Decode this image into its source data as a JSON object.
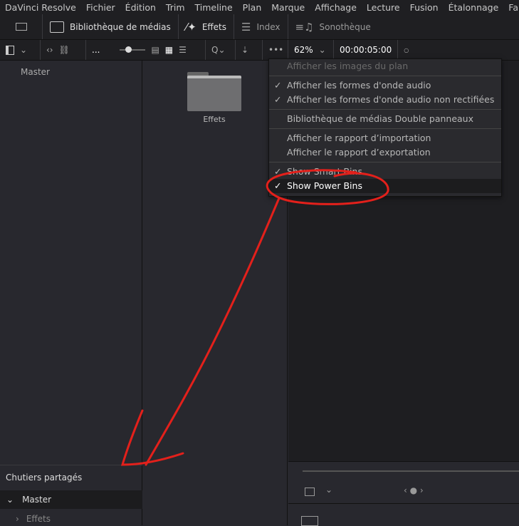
{
  "menubar": [
    "DaVinci Resolve",
    "Fichier",
    "Édition",
    "Trim",
    "Timeline",
    "Plan",
    "Marque",
    "Affichage",
    "Lecture",
    "Fusion",
    "Étalonnage",
    "Fairlight"
  ],
  "toolbar": {
    "media": "Bibliothèque de médias",
    "effects": "Effets",
    "index": "Index",
    "sound": "Sonothèque"
  },
  "toolbar2": {
    "more": "...",
    "zoom": "62%",
    "timecode": "00:00:05:00"
  },
  "left": {
    "master": "Master",
    "shared": "Chutiers partagés",
    "tree_master": "Master",
    "tree_effets": "Effets"
  },
  "bins": {
    "folder": "Effets"
  },
  "menu": {
    "items": [
      {
        "label": "Afficher les images du plan",
        "checked": false,
        "disabled": true
      },
      {
        "label": "Afficher les formes d'onde audio",
        "checked": true
      },
      {
        "label": "Afficher les formes d'onde audio non rectifiées",
        "checked": true
      },
      {
        "label": "Bibliothèque de médias Double panneaux",
        "checked": false
      },
      {
        "label": "Afficher le rapport d’importation",
        "checked": false
      },
      {
        "label": "Afficher le rapport d’exportation",
        "checked": false
      },
      {
        "label": "Show Smart Bins",
        "checked": true
      },
      {
        "label": "Show Power Bins",
        "checked": true,
        "highlighted": true
      }
    ],
    "check": "✓"
  },
  "annotation_color": "#e3201b"
}
